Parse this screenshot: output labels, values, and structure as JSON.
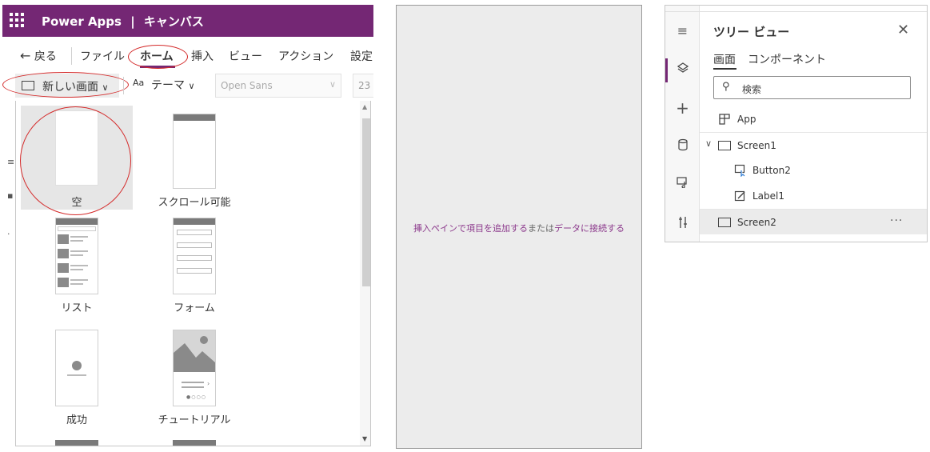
{
  "header": {
    "app_name": "Power Apps",
    "separator": "|",
    "section": "キャンバス"
  },
  "menu": {
    "back": "戻る",
    "file": "ファイル",
    "home": "ホーム",
    "insert": "挿入",
    "view": "ビュー",
    "action": "アクション",
    "settings": "設定"
  },
  "toolbar": {
    "new_screen": "新しい画面",
    "theme_icon_text": "Aa",
    "theme": "テーマ",
    "font": "Open Sans",
    "font_size": "23"
  },
  "templates": {
    "blank": "空",
    "scrollable": "スクロール可能",
    "list": "リスト",
    "form": "フォーム",
    "success": "成功",
    "tutorial": "チュートリアル"
  },
  "canvas": {
    "msg_part1": "挿入ペインで項目を追加する",
    "msg_part2": "または",
    "msg_part3": "データに接続する"
  },
  "tree": {
    "title": "ツリー ビュー",
    "tab_screens": "画面",
    "tab_components": "コンポーネント",
    "search_placeholder": "検索",
    "nodes": {
      "app": "App",
      "screen1": "Screen1",
      "button2": "Button2",
      "label1": "Label1",
      "screen2": "Screen2"
    }
  },
  "colors": {
    "brand": "#742774",
    "highlight_circle": "#d42a2a",
    "link": "#8c3a8c"
  }
}
